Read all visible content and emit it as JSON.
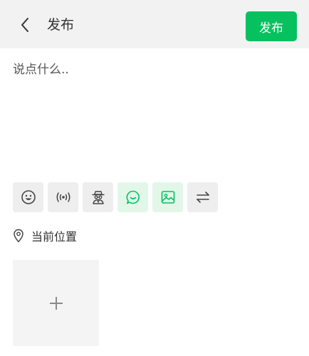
{
  "header": {
    "title": "发布",
    "publish_label": "发布"
  },
  "composer": {
    "placeholder": "说点什么..",
    "value": ""
  },
  "toolbar": {
    "items": [
      {
        "icon": "emoji-icon",
        "active": false
      },
      {
        "icon": "broadcast-icon",
        "active": false
      },
      {
        "icon": "anonymous-icon",
        "active": false
      },
      {
        "icon": "chat-bubble-icon",
        "active": true
      },
      {
        "icon": "image-icon",
        "active": true
      },
      {
        "icon": "swap-icon",
        "active": false
      }
    ]
  },
  "location": {
    "label": "当前位置"
  },
  "colors": {
    "accent": "#07c160",
    "header_bg": "#f2f2f2",
    "tool_bg": "#eeeeee",
    "tool_active_bg": "#e2f7ea"
  }
}
